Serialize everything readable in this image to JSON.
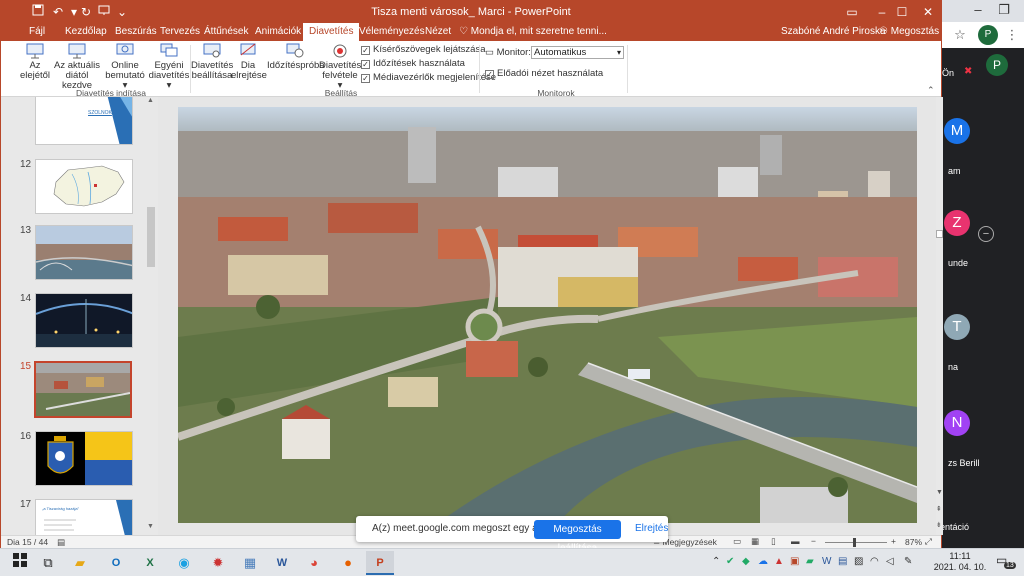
{
  "app": {
    "title": "Tisza menti városok_ Marci  -  PowerPoint",
    "user": "Szabóné André Piroska",
    "share": "Megosztás",
    "tell_me": "Mondja el, mit szeretne tenni..."
  },
  "tabs": [
    "Fájl",
    "Kezdőlap",
    "Beszúrás",
    "Tervezés",
    "Áttűnések",
    "Animációk",
    "Diavetítés",
    "Véleményezés",
    "Nézet"
  ],
  "active_tab": "Diavetítés",
  "ribbon": {
    "start": {
      "from_start": [
        "Az",
        "elejétől"
      ],
      "from_current": [
        "Az aktuális",
        "diától kezdve"
      ],
      "online": [
        "Online",
        "bemutató"
      ],
      "custom": [
        "Egyéni",
        "diavetítés"
      ],
      "label": "Diavetítés indítása"
    },
    "setup": {
      "setup": [
        "Diavetítés",
        "beállítása"
      ],
      "hide": [
        "Dia",
        "elrejtése"
      ],
      "rehearse": "Időzítéspróba",
      "record": [
        "Diavetítés",
        "felvétele"
      ],
      "checks": [
        "Kísérőszövegek lejátszása",
        "Időzítések használata",
        "Médiavezérlők megjelenítése"
      ],
      "label": "Beállítás"
    },
    "monitors": {
      "monitor_label": "Monitor:",
      "monitor_value": "Automatikus",
      "presenter_view": "Előadói nézet használata",
      "label": "Monitorok"
    }
  },
  "thumbnails": [
    {
      "num": "",
      "label": "SZOLNOK"
    },
    {
      "num": "12",
      "label": ""
    },
    {
      "num": "13",
      "label": ""
    },
    {
      "num": "14",
      "label": ""
    },
    {
      "num": "15",
      "label": ""
    },
    {
      "num": "16",
      "label": ""
    },
    {
      "num": "17",
      "label": "„a Tiszavirág hazája”"
    }
  ],
  "status": {
    "slide_counter": "Dia 15 / 44",
    "notes": "Megjegyzések",
    "zoom": "87%"
  },
  "notification": {
    "text": "A(z) meet.google.com megoszt egy ablakot.",
    "stop": "Megosztás leállítása",
    "hide": "Elrejtés"
  },
  "meet": {
    "self_label": "Ön",
    "participants": [
      {
        "initial": "M",
        "name": "am",
        "color": "#1a73e8"
      },
      {
        "initial": "Z",
        "name": "unde",
        "color": "#e8336f"
      },
      {
        "initial": "T",
        "name": "na",
        "color": "#8fa8b5"
      },
      {
        "initial": "N",
        "name": "zs Berill",
        "color": "#a142f4"
      }
    ],
    "present_label": "entáció"
  },
  "taskbar": {
    "time": "11:11",
    "date": "2021. 04. 10.",
    "badge": "13"
  }
}
